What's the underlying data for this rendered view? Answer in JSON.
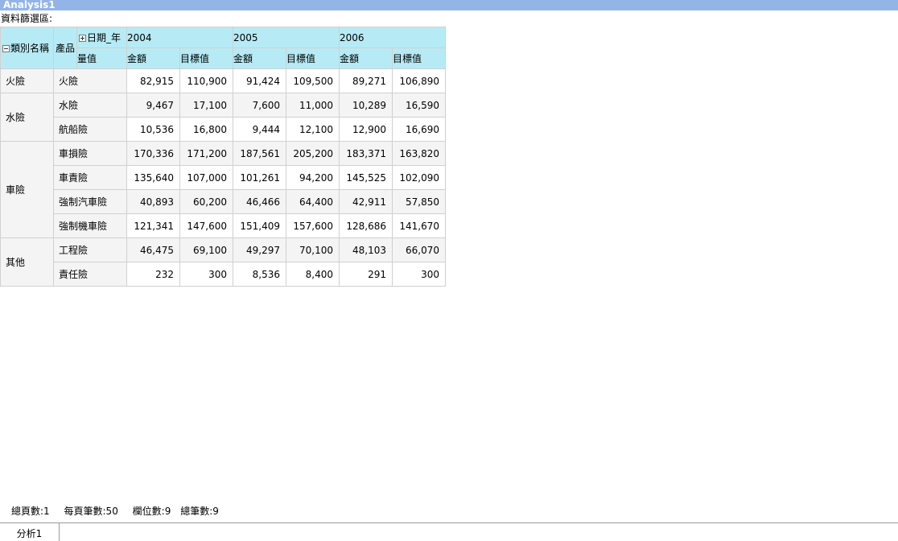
{
  "window": {
    "title": "Analysis1"
  },
  "filter": {
    "label": "資料篩選區:"
  },
  "pivot": {
    "corner": {
      "category_header": "類別名稱",
      "product_header": "產品",
      "date_header": "日期_年",
      "measure_header": "量值"
    },
    "years": [
      "2004",
      "2005",
      "2006"
    ],
    "measures": [
      "金額",
      "目標值"
    ],
    "groups": [
      {
        "category": "火險",
        "rows": [
          {
            "product": "火險",
            "values": [
              "82,915",
              "110,900",
              "91,424",
              "109,500",
              "89,271",
              "106,890"
            ]
          }
        ]
      },
      {
        "category": "水險",
        "rows": [
          {
            "product": "水險",
            "values": [
              "9,467",
              "17,100",
              "7,600",
              "11,000",
              "10,289",
              "16,590"
            ]
          },
          {
            "product": "航船險",
            "values": [
              "10,536",
              "16,800",
              "9,444",
              "12,100",
              "12,900",
              "16,690"
            ]
          }
        ]
      },
      {
        "category": "車險",
        "rows": [
          {
            "product": "車損險",
            "values": [
              "170,336",
              "171,200",
              "187,561",
              "205,200",
              "183,371",
              "163,820"
            ]
          },
          {
            "product": "車責險",
            "values": [
              "135,640",
              "107,000",
              "101,261",
              "94,200",
              "145,525",
              "102,090"
            ]
          },
          {
            "product": "強制汽車險",
            "values": [
              "40,893",
              "60,200",
              "46,466",
              "64,400",
              "42,911",
              "57,850"
            ]
          },
          {
            "product": "強制機車險",
            "values": [
              "121,341",
              "147,600",
              "151,409",
              "157,600",
              "128,686",
              "141,670"
            ]
          }
        ]
      },
      {
        "category": "其他",
        "rows": [
          {
            "product": "工程險",
            "values": [
              "46,475",
              "69,100",
              "49,297",
              "70,100",
              "48,103",
              "66,070"
            ]
          },
          {
            "product": "責任險",
            "values": [
              "232",
              "300",
              "8,536",
              "8,400",
              "291",
              "300"
            ]
          }
        ]
      }
    ]
  },
  "status": {
    "total_pages": "總頁數:1",
    "per_page": "每頁筆數:50",
    "columns": "欄位數:9",
    "total_records": "總筆數:9"
  },
  "tabs": [
    {
      "label": "分析1"
    }
  ]
}
